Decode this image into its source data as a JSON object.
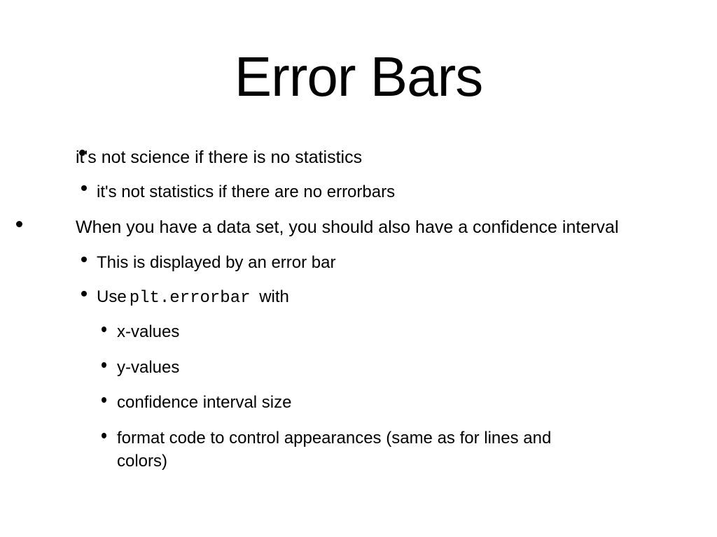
{
  "slide": {
    "title": "Error Bars",
    "bullets": [
      {
        "text": "it's not science if there is no statistics",
        "children": [
          {
            "text": "it's not statistics if there are no errorbars"
          }
        ]
      },
      {
        "text": "When you have a data set, you should also have a confidence interval",
        "children": [
          {
            "text": "This is displayed by an error bar"
          },
          {
            "prefix": "Use",
            "code": "plt.errorbar",
            "suffix": "with",
            "children": [
              {
                "text": "x-values"
              },
              {
                "text": "y-values"
              },
              {
                "text": "confidence interval size"
              },
              {
                "text": "format code to control appearances (same as for lines and",
                "continuation": "colors)"
              }
            ]
          }
        ]
      }
    ]
  }
}
